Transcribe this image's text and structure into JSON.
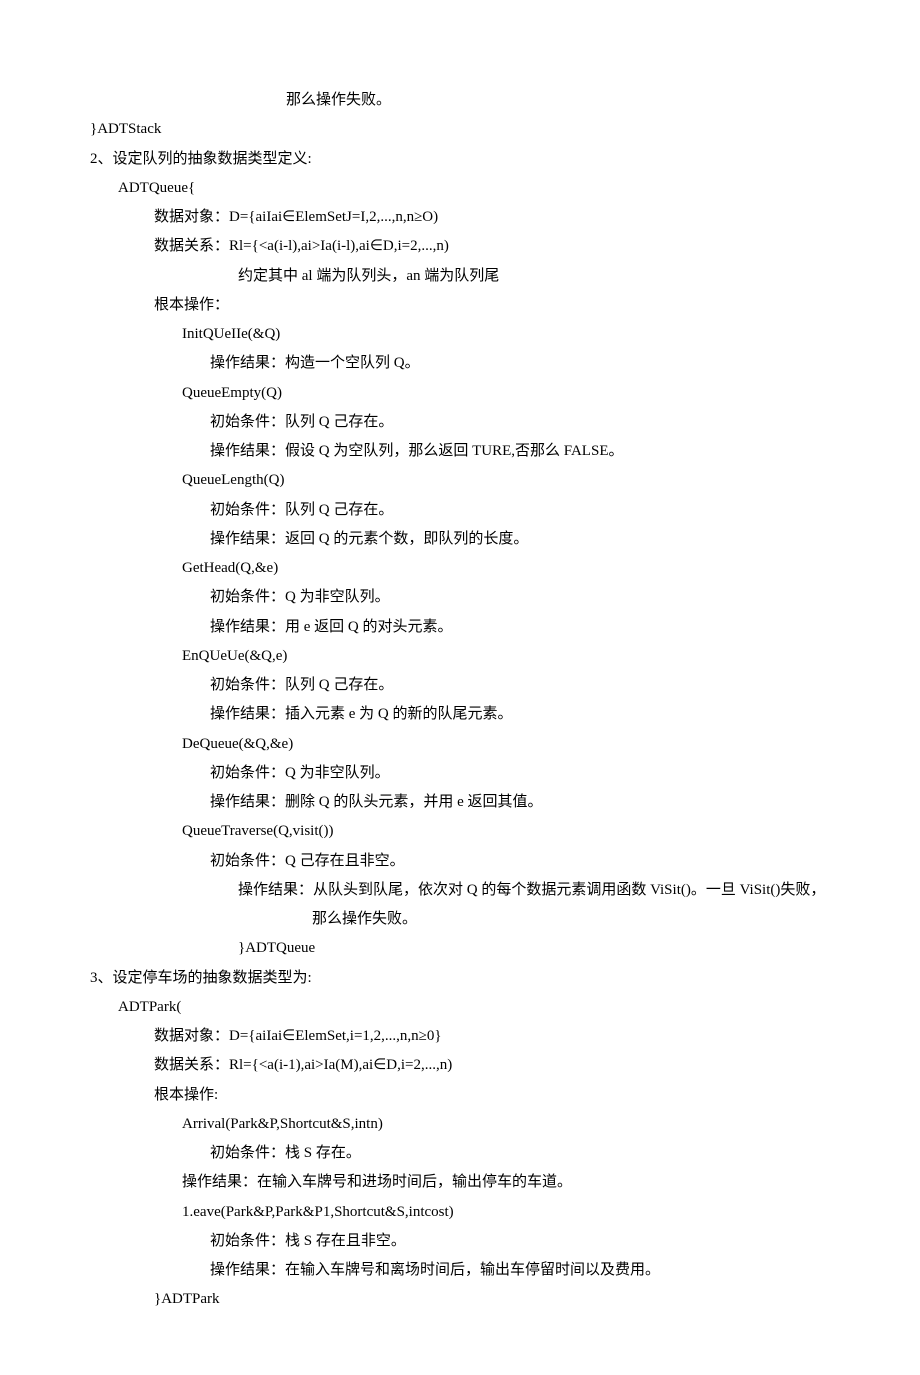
{
  "lines": [
    {
      "cls": "lcenter",
      "text": "那么操作失败。"
    },
    {
      "cls": "l0",
      "text": "}ADTStack"
    },
    {
      "cls": "l0",
      "text": "2、设定队列的抽象数据类型定义:"
    },
    {
      "cls": "l1",
      "text": "ADTQueue{"
    },
    {
      "cls": "l2",
      "text": "数据对象：D={aiIai∈ElemSetJ=I,2,...,n,n≥O)"
    },
    {
      "cls": "l2",
      "text": "数据关系：Rl={<a(i-l),ai>Ia(i-l),ai∈D,i=2,...,n)"
    },
    {
      "cls": "l5",
      "text": "约定其中 al 端为队列头，an 端为队列尾"
    },
    {
      "cls": "l2",
      "text": "根本操作："
    },
    {
      "cls": "l3",
      "text": "InitQUeIIe(&Q)"
    },
    {
      "cls": "l4",
      "text": "操作结果：构造一个空队列 Q。"
    },
    {
      "cls": "l3",
      "text": "QueueEmpty(Q)"
    },
    {
      "cls": "l4",
      "text": "初始条件：队列 Q 己存在。"
    },
    {
      "cls": "l4",
      "text": "操作结果：假设 Q 为空队列，那么返回 TURE,否那么 FALSE。"
    },
    {
      "cls": "l3",
      "text": "QueueLength(Q)"
    },
    {
      "cls": "l4",
      "text": "初始条件：队列 Q 己存在。"
    },
    {
      "cls": "l4",
      "text": "操作结果：返回 Q 的元素个数，即队列的长度。"
    },
    {
      "cls": "l3",
      "text": "GetHead(Q,&e)"
    },
    {
      "cls": "l4",
      "text": "初始条件：Q 为非空队列。"
    },
    {
      "cls": "l4",
      "text": "操作结果：用 e 返回 Q 的对头元素。"
    },
    {
      "cls": "l3",
      "text": "EnQUeUe(&Q,e)"
    },
    {
      "cls": "l4",
      "text": "初始条件：队列 Q 己存在。"
    },
    {
      "cls": "l4",
      "text": "操作结果：插入元素 e 为 Q 的新的队尾元素。"
    },
    {
      "cls": "l3",
      "text": "DeQueue(&Q,&e)"
    },
    {
      "cls": "l4",
      "text": "初始条件：Q 为非空队列。"
    },
    {
      "cls": "l4",
      "text": "操作结果：删除 Q 的队头元素，并用 e 返回其值。"
    },
    {
      "cls": "l3",
      "text": "QueueTraverse(Q,visit())"
    },
    {
      "cls": "l4",
      "text": "初始条件：Q 己存在且非空。"
    },
    {
      "cls": "hang",
      "text": "操作结果：从队头到队尾，依次对 Q 的每个数据元素调用函数 ViSit()。一旦 ViSit()失败，那么操作失败。"
    },
    {
      "cls": "l5",
      "text": "}ADTQueue"
    },
    {
      "cls": "l0",
      "text": "3、设定停车场的抽象数据类型为:"
    },
    {
      "cls": "l1",
      "text": "ADTPark("
    },
    {
      "cls": "l2",
      "text": "数据对象：D={aiIai∈ElemSet,i=1,2,...,n,n≥0}"
    },
    {
      "cls": "l2",
      "text": "数据关系：Rl={<a(i-1),ai>Ia(M),ai∈D,i=2,...,n)"
    },
    {
      "cls": "l2",
      "text": "根本操作:"
    },
    {
      "cls": "l3",
      "text": "Arrival(Park&P,Shortcut&S,intn)"
    },
    {
      "cls": "l4",
      "text": "初始条件：栈 S 存在。"
    },
    {
      "cls": "l3",
      "text": "操作结果：在输入车牌号和进场时间后，输出停车的车道。"
    },
    {
      "cls": "l3",
      "text": "1.eave(Park&P,Park&P1,Shortcut&S,intcost)"
    },
    {
      "cls": "l4",
      "text": "初始条件：栈 S 存在且非空。"
    },
    {
      "cls": "l4",
      "text": "操作结果：在输入车牌号和离场时间后，输出车停留时间以及费用。"
    },
    {
      "cls": "l2",
      "text": "}ADTPark"
    }
  ]
}
